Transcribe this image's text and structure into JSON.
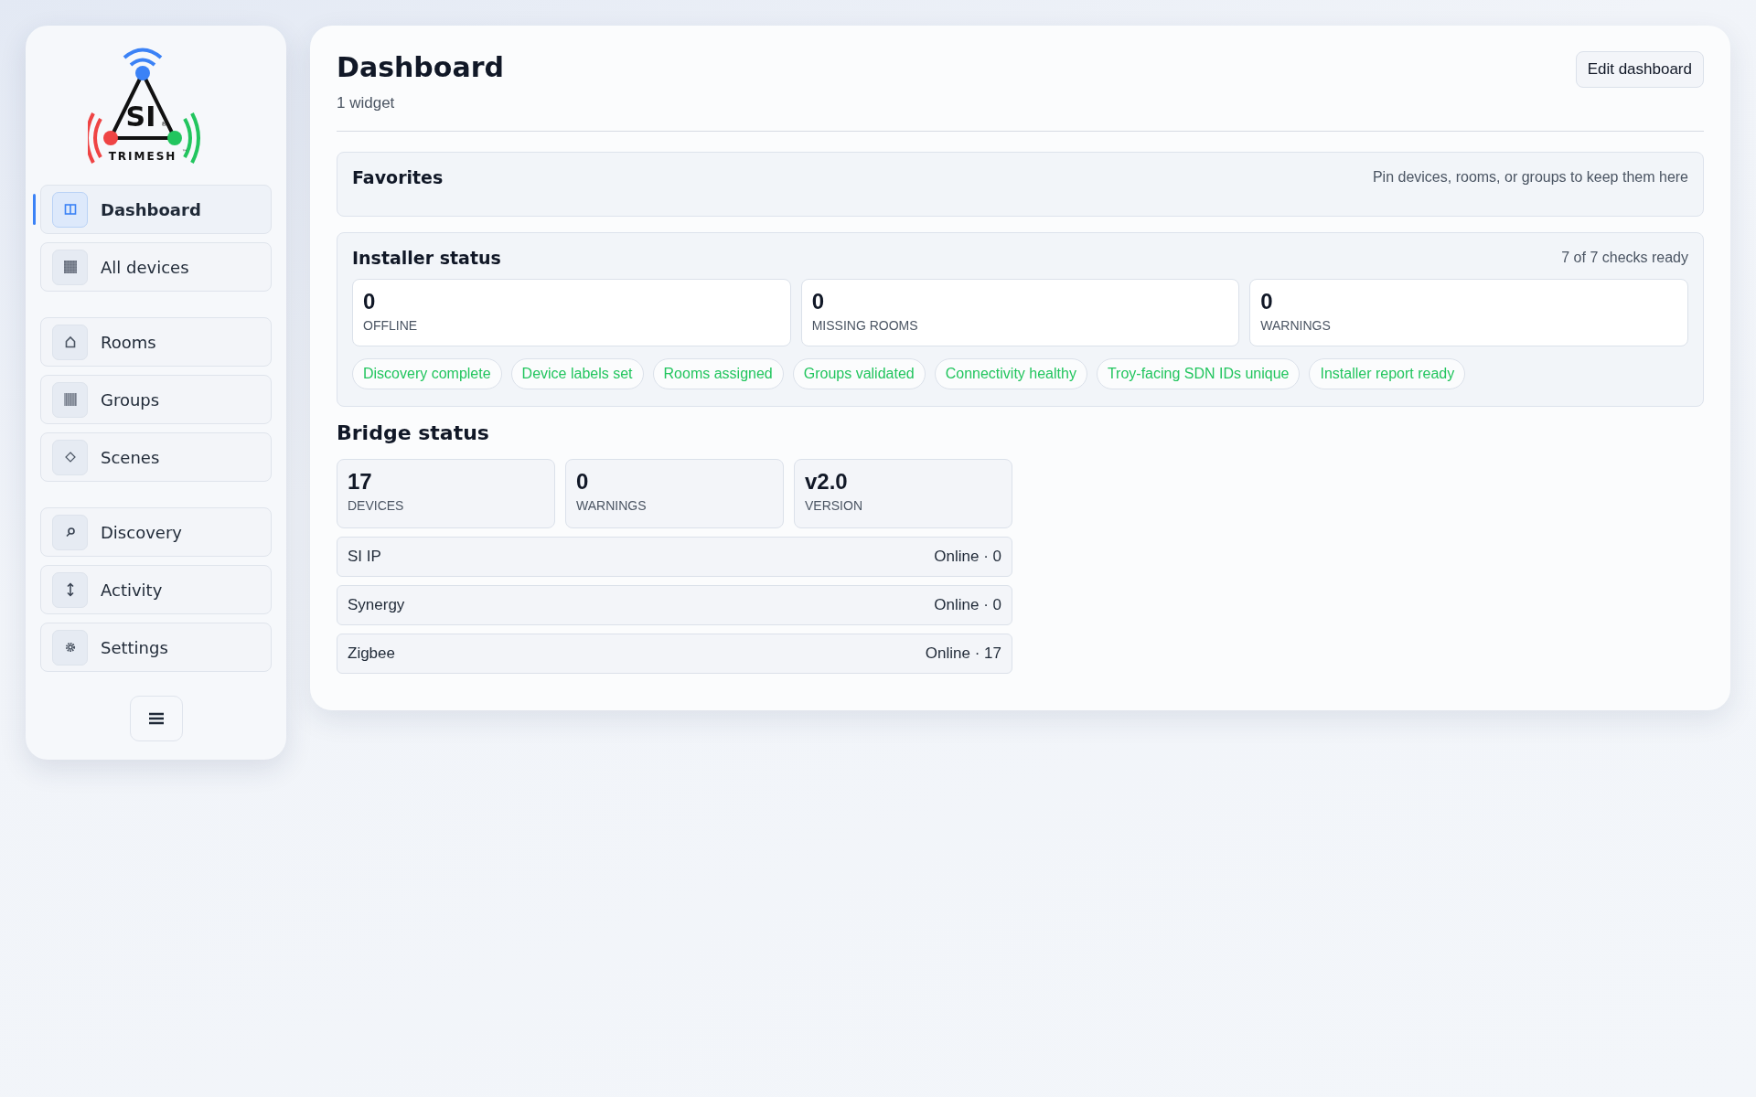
{
  "logo": {
    "mark": "SI",
    "registered": "®",
    "name": "TRIMESH",
    "trademark": "™"
  },
  "sidebar": {
    "groups": [
      {
        "items": [
          {
            "label": "Dashboard",
            "kind": "dashboard",
            "selected": true
          },
          {
            "label": "All devices",
            "kind": "devices",
            "selected": false
          }
        ]
      },
      {
        "items": [
          {
            "label": "Rooms",
            "kind": "rooms",
            "selected": false
          },
          {
            "label": "Groups",
            "kind": "groups",
            "selected": false
          },
          {
            "label": "Scenes",
            "kind": "scenes",
            "selected": false
          }
        ]
      },
      {
        "items": [
          {
            "label": "Discovery",
            "kind": "discovery",
            "selected": false
          },
          {
            "label": "Activity",
            "kind": "activity",
            "selected": false
          },
          {
            "label": "Settings",
            "kind": "settings",
            "selected": false
          }
        ]
      }
    ]
  },
  "header": {
    "title": "Dashboard",
    "subtitle": "1 widget",
    "edit_button": "Edit dashboard"
  },
  "favorites": {
    "title": "Favorites",
    "hint": "Pin devices, rooms, or groups to keep them here"
  },
  "installer_status": {
    "title": "Installer status",
    "summary": "7 of 7 checks ready",
    "stats": [
      {
        "value": "0",
        "label": "OFFLINE"
      },
      {
        "value": "0",
        "label": "MISSING ROOMS"
      },
      {
        "value": "0",
        "label": "WARNINGS"
      }
    ],
    "checks": [
      "Discovery complete",
      "Device labels set",
      "Rooms assigned",
      "Groups validated",
      "Connectivity healthy",
      "Troy-facing SDN IDs unique",
      "Installer report ready"
    ]
  },
  "bridge_status": {
    "title": "Bridge status",
    "stats": [
      {
        "value": "17",
        "label": "DEVICES"
      },
      {
        "value": "0",
        "label": "WARNINGS"
      },
      {
        "value": "v2.0",
        "label": "VERSION"
      }
    ],
    "bridges": [
      {
        "name": "SI IP",
        "status": "Online · 0"
      },
      {
        "name": "Synergy",
        "status": "Online · 0"
      },
      {
        "name": "Zigbee",
        "status": "Online · 17"
      }
    ]
  }
}
